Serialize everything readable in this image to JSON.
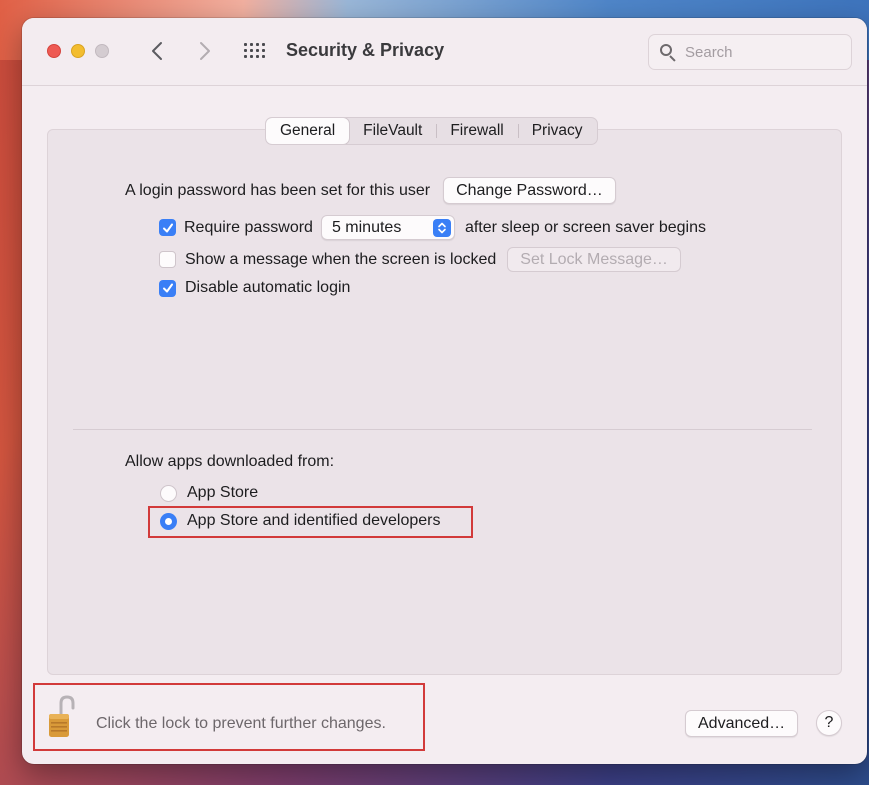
{
  "window": {
    "title": "Security & Privacy"
  },
  "search": {
    "placeholder": "Search"
  },
  "tabs": [
    {
      "label": "General",
      "active": true
    },
    {
      "label": "FileVault",
      "active": false
    },
    {
      "label": "Firewall",
      "active": false
    },
    {
      "label": "Privacy",
      "active": false
    }
  ],
  "general": {
    "login_text": "A login password has been set for this user",
    "change_password_label": "Change Password…",
    "require_password": {
      "label": "Require password",
      "checked": true,
      "delay_value": "5 minutes",
      "suffix": "after sleep or screen saver begins"
    },
    "show_message": {
      "label": "Show a message when the screen is locked",
      "checked": false,
      "button_label": "Set Lock Message…"
    },
    "disable_auto_login": {
      "label": "Disable automatic login",
      "checked": true
    }
  },
  "allow_apps": {
    "heading": "Allow apps downloaded from:",
    "options": [
      {
        "label": "App Store",
        "selected": false
      },
      {
        "label": "App Store and identified developers",
        "selected": true
      }
    ]
  },
  "footer": {
    "lock_text": "Click the lock to prevent further changes.",
    "advanced_label": "Advanced…",
    "help_label": "?"
  },
  "colors": {
    "accent": "#3a7ff6",
    "highlight": "#d23a3a",
    "close": "#ee5a53",
    "minimize": "#f3bd2f"
  }
}
